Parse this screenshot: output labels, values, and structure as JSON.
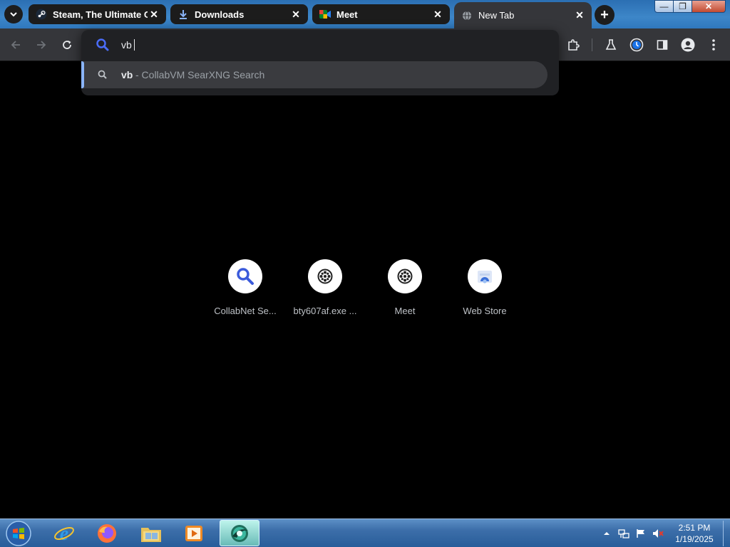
{
  "tabs": [
    {
      "title": "Steam, The Ultimate Or",
      "icon": "steam-icon"
    },
    {
      "title": "Downloads",
      "icon": "download-icon"
    },
    {
      "title": "Meet",
      "icon": "meet-icon"
    },
    {
      "title": "New Tab",
      "icon": "globe-icon"
    }
  ],
  "tab_close_glyph": "✕",
  "new_tab_glyph": "+",
  "window_controls": {
    "minimize": "—",
    "maximize": "❐",
    "close": "✕"
  },
  "omnibox": {
    "input_value": "vb",
    "suggestion_query": "vb",
    "suggestion_desc": "- CollabVM SearXNG Search"
  },
  "shortcuts": [
    {
      "label": "CollabNet Se...",
      "icon": "search-icon"
    },
    {
      "label": "bty607af.exe ...",
      "icon": "film-reel-icon"
    },
    {
      "label": "Meet",
      "icon": "film-reel-icon"
    },
    {
      "label": "Web Store",
      "icon": "web-store-icon"
    }
  ],
  "taskbar": {
    "apps": [
      "internet-explorer-icon",
      "firefox-icon",
      "file-explorer-icon",
      "media-player-icon",
      "chromium-icon"
    ],
    "time": "2:51 PM",
    "date": "1/19/2025"
  },
  "colors": {
    "accent": "#8ab4f8",
    "search_blue": "#4a6cf7",
    "toolbar": "#35363a"
  }
}
